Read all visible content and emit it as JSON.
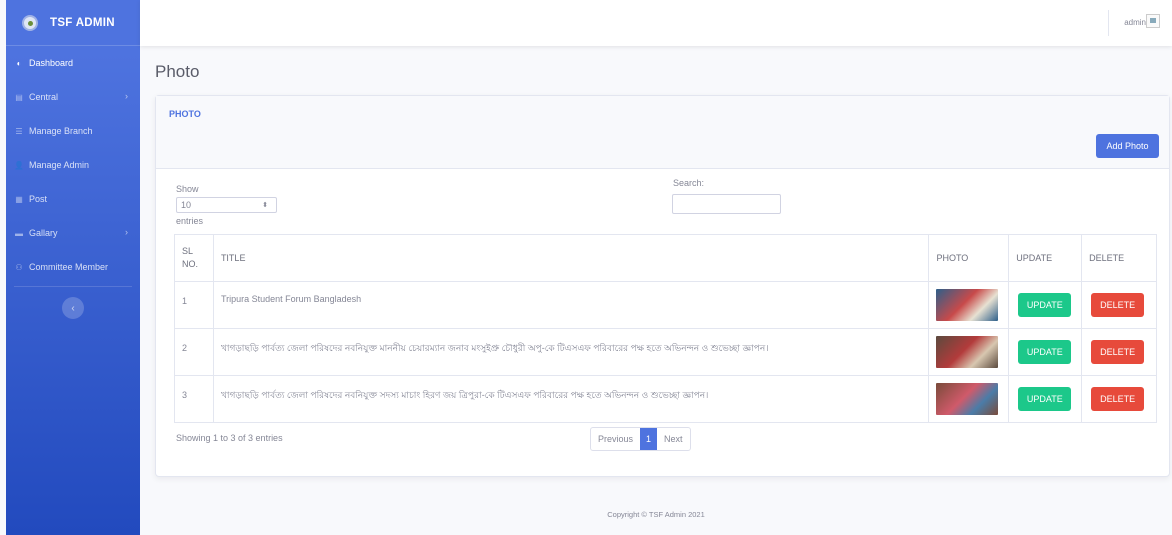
{
  "brand": {
    "name": "TSF ADMIN"
  },
  "sidebar": {
    "items": [
      {
        "label": "Dashboard",
        "icon": "tachometer-icon",
        "glyph": "◐",
        "active": true,
        "has_children": false
      },
      {
        "label": "Central",
        "icon": "folder-icon",
        "glyph": "▤",
        "active": false,
        "has_children": true
      },
      {
        "label": "Manage Branch",
        "icon": "list-icon",
        "glyph": "☰",
        "active": false,
        "has_children": false
      },
      {
        "label": "Manage Admin",
        "icon": "user-icon",
        "glyph": "👤",
        "active": false,
        "has_children": false
      },
      {
        "label": "Post",
        "icon": "post-icon",
        "glyph": "▦",
        "active": false,
        "has_children": false
      },
      {
        "label": "Gallary",
        "icon": "images-icon",
        "glyph": "▬",
        "active": false,
        "has_children": true
      },
      {
        "label": "Committee Member",
        "icon": "users-icon",
        "glyph": "⚇",
        "active": false,
        "has_children": false
      }
    ],
    "toggle_glyph": "‹"
  },
  "topbar": {
    "user_name": "admin"
  },
  "page": {
    "title": "Photo"
  },
  "card": {
    "title": "PHOTO",
    "add_button": "Add Photo",
    "show_label": "Show",
    "page_size": "10",
    "entries_label": "entries",
    "search_label": "Search:"
  },
  "table": {
    "headers": {
      "sl_line1": "SL",
      "sl_line2": "NO.",
      "title": "TITLE",
      "photo": "PHOTO",
      "update": "UPDATE",
      "delete": "DELETE"
    },
    "rows": [
      {
        "sl": "1",
        "title": "Tripura Student Forum Bangladesh",
        "update": "UPDATE",
        "delete": "DELETE",
        "photo_colors": [
          "#2d5f8a",
          "#c84a4a",
          "#e7e1d2"
        ]
      },
      {
        "sl": "2",
        "title": "খাগড়াছড়ি পার্বত্য জেলা পরিষদের নবনিযুক্ত মাননীয় চেয়ারম্যান জনাব মংসুইপ্রু চৌধুরী অপু-কে টিএসএফ পরিবারের পক্ষ হতে অভিনন্দন ও শুভেচ্ছা জ্ঞাপন।",
        "update": "UPDATE",
        "delete": "DELETE",
        "photo_colors": [
          "#5b4a3e",
          "#b33b3b",
          "#d8c7b0"
        ]
      },
      {
        "sl": "3",
        "title": "খাগড়াছড়ি পার্বত্য জেলা পরিষদের নবনিযুক্ত সদস্য মাচাং হিরণ জয় ত্রিপুরা-কে টিএসএফ পরিবারের পক্ষ হতে অভিনন্দন ও শুভেচ্ছা জ্ঞাপন।",
        "update": "UPDATE",
        "delete": "DELETE",
        "photo_colors": [
          "#7a4b3a",
          "#d05a6a",
          "#4a7ca8"
        ]
      }
    ]
  },
  "info": "Showing 1 to 3 of 3 entries",
  "pagination": {
    "previous": "Previous",
    "current": "1",
    "next": "Next"
  },
  "footer": "Copyright © TSF Admin 2021",
  "colors": {
    "primary": "#4e73df",
    "success": "#1cc88a",
    "danger": "#e74a3b"
  }
}
